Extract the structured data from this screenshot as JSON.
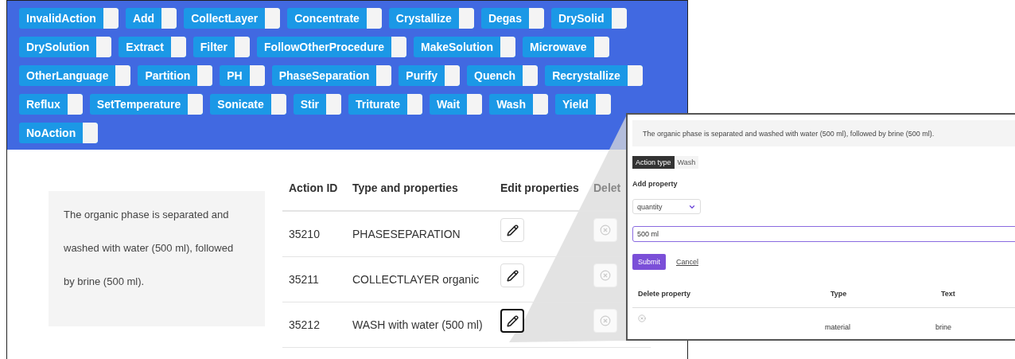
{
  "action_buttons": [
    "InvalidAction",
    "Add",
    "CollectLayer",
    "Concentrate",
    "Crystallize",
    "Degas",
    "DrySolid",
    "DrySolution",
    "Extract",
    "Filter",
    "FollowOtherProcedure",
    "MakeSolution",
    "Microwave",
    "OtherLanguage",
    "Partition",
    "PH",
    "PhaseSeparation",
    "Purify",
    "Quench",
    "Recrystallize",
    "Reflux",
    "SetTemperature",
    "Sonicate",
    "Stir",
    "Triturate",
    "Wait",
    "Wash",
    "Yield",
    "NoAction"
  ],
  "source_text": {
    "lines": [
      "The organic phase is separated and",
      "washed with water (500 ml), followed",
      "by brine (500 ml)."
    ]
  },
  "actions_table": {
    "columns": [
      "Action ID",
      "Type and properties",
      "Edit properties",
      "Delet"
    ],
    "rows": [
      {
        "id": "35210",
        "type": "PHASESEPARATION",
        "selected": false
      },
      {
        "id": "35211",
        "type": "COLLECTLAYER organic",
        "selected": false
      },
      {
        "id": "35212",
        "type": "WASH with water (500 ml)",
        "selected": true
      }
    ]
  },
  "edit_panel": {
    "text": "The organic phase is separated and washed with water (500 ml), followed by brine (500 ml).",
    "action_type_label": "Action type",
    "action_type_value": "Wash",
    "add_property_label": "Add property",
    "property_select": "quantity",
    "property_value": "500 ml",
    "submit": "Submit",
    "cancel": "Cancel",
    "columns": [
      "Delete property",
      "Type",
      "Text"
    ],
    "rows": [
      {
        "type": "material",
        "text": "brine"
      }
    ]
  }
}
